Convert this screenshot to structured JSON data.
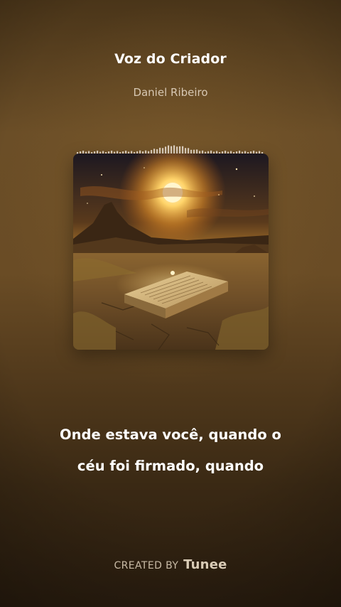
{
  "song": {
    "title": "Voz do Criador",
    "artist": "Daniel Ribeiro"
  },
  "cover": {
    "icon": "cover-art-desert-book-image"
  },
  "lyrics": {
    "line1": "Onde estava você, quando o",
    "line2": "céu foi firmado, quando"
  },
  "footer": {
    "created_by": "CREATED BY",
    "brand": "Tunee"
  },
  "colors": {
    "background": "#6a4c25",
    "text": "#ffffff",
    "muted_text": "#d7c8b3",
    "waveform": "#f3e9dc"
  }
}
